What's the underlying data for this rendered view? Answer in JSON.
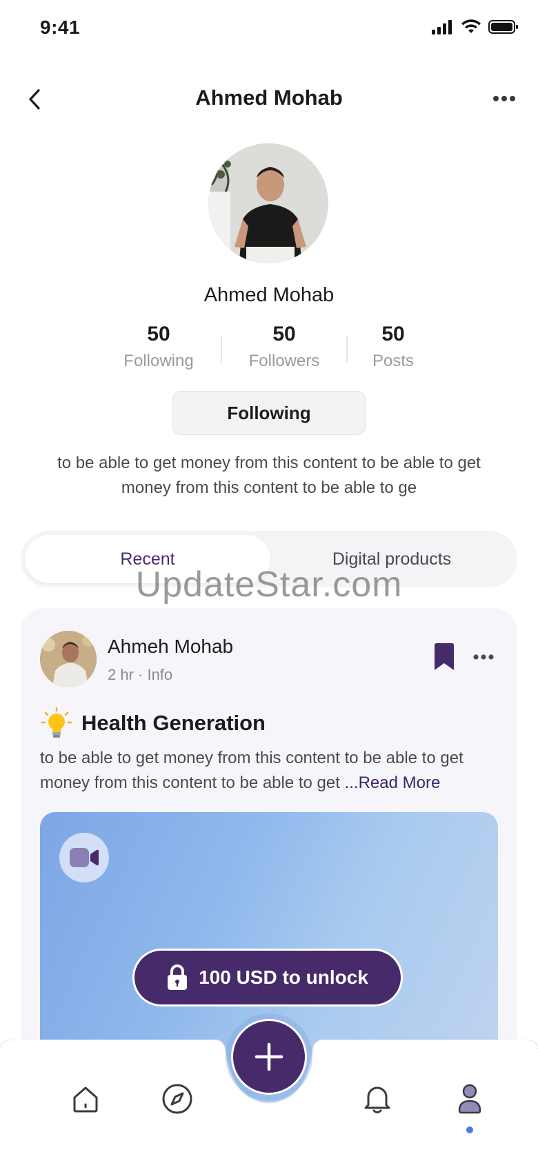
{
  "status_bar": {
    "time": "9:41"
  },
  "header": {
    "title": "Ahmed Mohab"
  },
  "profile": {
    "name": "Ahmed Mohab",
    "stats": [
      {
        "value": "50",
        "label": "Following"
      },
      {
        "value": "50",
        "label": "Followers"
      },
      {
        "value": "50",
        "label": "Posts"
      }
    ],
    "follow_button": "Following",
    "bio": "to be able to get money from this content to be able to get money from this content to be able to ge"
  },
  "tabs": [
    {
      "label": "Recent",
      "active": true
    },
    {
      "label": "Digital products",
      "active": false
    }
  ],
  "watermark": "UpdateStar.com",
  "post": {
    "author": "Ahmeh Mohab",
    "meta": "2 hr · Info",
    "title": "Health Generation",
    "body": "to be able to get money from this content to be able to get money from this content to be able to get ",
    "read_more": "...Read More",
    "unlock_label": "100 USD to unlock"
  },
  "colors": {
    "brand": "#472a6a",
    "accent_blue": "#4b7be6",
    "muted_text": "#9a9a9f"
  },
  "icons": {
    "back": "chevron-left-icon",
    "more": "more-horizontal-icon",
    "bookmark": "bookmark-icon",
    "lightbulb": "lightbulb-icon",
    "video": "video-camera-icon",
    "lock": "lock-icon",
    "home": "home-icon",
    "explore": "compass-icon",
    "add": "plus-icon",
    "notifications": "bell-icon",
    "profile": "user-icon"
  }
}
